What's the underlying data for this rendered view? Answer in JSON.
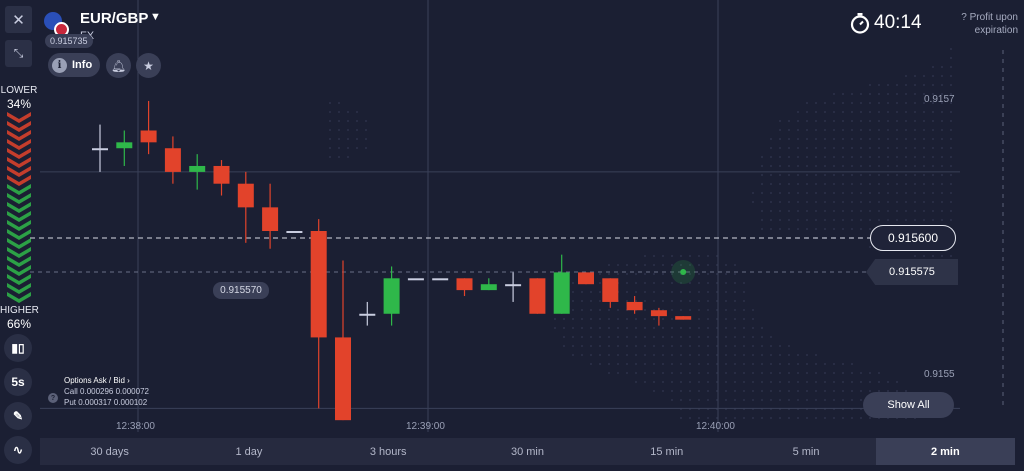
{
  "header": {
    "asset": "EUR/GBP",
    "asset_type": "FX",
    "top_price_chip": "0.915735",
    "info_label": "Info"
  },
  "timer": {
    "value": "40:14"
  },
  "profit": {
    "label": "Profit upon expiration",
    "help_icon": "question-icon"
  },
  "sidebar": {
    "lower_label": "LOWER",
    "lower_pct": "34%",
    "higher_label": "HIGHER",
    "higher_pct": "66%",
    "interval_label": "5s",
    "lower_fraction": 0.34,
    "higher_fraction": 0.66
  },
  "price_axis": {
    "top_label": "0.9157",
    "bottom_label": "0.9155",
    "current_price": "0.915600",
    "expiry_price": "0.915575",
    "marker_price": "0.915570"
  },
  "time_axis": {
    "labels": [
      "12:38:00",
      "12:39:00",
      "12:40:00"
    ]
  },
  "options": {
    "title": "Options Ask / Bid",
    "call_label": "Call",
    "call_values": "0.000296  0.000072",
    "put_label": "Put",
    "put_values": "0.000317  0.000102"
  },
  "show_all_label": "Show All",
  "timeframes": [
    {
      "label": "30 days",
      "active": false
    },
    {
      "label": "1 day",
      "active": false
    },
    {
      "label": "3 hours",
      "active": false
    },
    {
      "label": "30 min",
      "active": false
    },
    {
      "label": "15 min",
      "active": false
    },
    {
      "label": "5 min",
      "active": false
    },
    {
      "label": "2 min",
      "active": true
    }
  ],
  "colors": {
    "background": "#1b1f33",
    "up": "#2fb84a",
    "down": "#e2432b",
    "grid": "#3b4159"
  },
  "chart_data": {
    "type": "candlestick",
    "price_range": [
      0.91548,
      0.91582
    ],
    "candles": [
      {
        "t": 0,
        "o": 0.91572,
        "h": 0.91574,
        "l": 0.9157,
        "c": 0.91572
      },
      {
        "t": 1,
        "o": 0.91572,
        "h": 0.915735,
        "l": 0.915705,
        "c": 0.915725
      },
      {
        "t": 2,
        "o": 0.915735,
        "h": 0.91576,
        "l": 0.915715,
        "c": 0.915725
      },
      {
        "t": 3,
        "o": 0.91572,
        "h": 0.91573,
        "l": 0.91569,
        "c": 0.9157
      },
      {
        "t": 4,
        "o": 0.9157,
        "h": 0.915715,
        "l": 0.915685,
        "c": 0.915705
      },
      {
        "t": 5,
        "o": 0.915705,
        "h": 0.91571,
        "l": 0.91568,
        "c": 0.91569
      },
      {
        "t": 6,
        "o": 0.91569,
        "h": 0.9157,
        "l": 0.91564,
        "c": 0.91567
      },
      {
        "t": 7,
        "o": 0.91567,
        "h": 0.91569,
        "l": 0.915635,
        "c": 0.91565
      },
      {
        "t": 8,
        "o": 0.91565,
        "h": 0.91565,
        "l": 0.91565,
        "c": 0.91565
      },
      {
        "t": 9,
        "o": 0.91565,
        "h": 0.91566,
        "l": 0.9155,
        "c": 0.91556
      },
      {
        "t": 10,
        "o": 0.91556,
        "h": 0.915625,
        "l": 0.91549,
        "c": 0.91549
      },
      {
        "t": 11,
        "o": 0.91558,
        "h": 0.91559,
        "l": 0.91557,
        "c": 0.91558
      },
      {
        "t": 12,
        "o": 0.91558,
        "h": 0.91562,
        "l": 0.91557,
        "c": 0.91561
      },
      {
        "t": 13,
        "o": 0.91561,
        "h": 0.91561,
        "l": 0.91561,
        "c": 0.91561
      },
      {
        "t": 14,
        "o": 0.91561,
        "h": 0.91561,
        "l": 0.91561,
        "c": 0.91561
      },
      {
        "t": 15,
        "o": 0.91561,
        "h": 0.91561,
        "l": 0.915595,
        "c": 0.9156
      },
      {
        "t": 16,
        "o": 0.9156,
        "h": 0.91561,
        "l": 0.9156,
        "c": 0.915605
      },
      {
        "t": 17,
        "o": 0.915605,
        "h": 0.915615,
        "l": 0.91559,
        "c": 0.915605
      },
      {
        "t": 18,
        "o": 0.91561,
        "h": 0.91561,
        "l": 0.91558,
        "c": 0.91558
      },
      {
        "t": 19,
        "o": 0.91558,
        "h": 0.91563,
        "l": 0.91558,
        "c": 0.915615
      },
      {
        "t": 20,
        "o": 0.915615,
        "h": 0.915615,
        "l": 0.915605,
        "c": 0.915605
      },
      {
        "t": 21,
        "o": 0.91561,
        "h": 0.91561,
        "l": 0.915585,
        "c": 0.91559
      },
      {
        "t": 22,
        "o": 0.91559,
        "h": 0.915595,
        "l": 0.91558,
        "c": 0.915583
      },
      {
        "t": 23,
        "o": 0.915583,
        "h": 0.915585,
        "l": 0.91557,
        "c": 0.915578
      },
      {
        "t": 24,
        "o": 0.915578,
        "h": 0.915578,
        "l": 0.915575,
        "c": 0.915575
      }
    ]
  }
}
